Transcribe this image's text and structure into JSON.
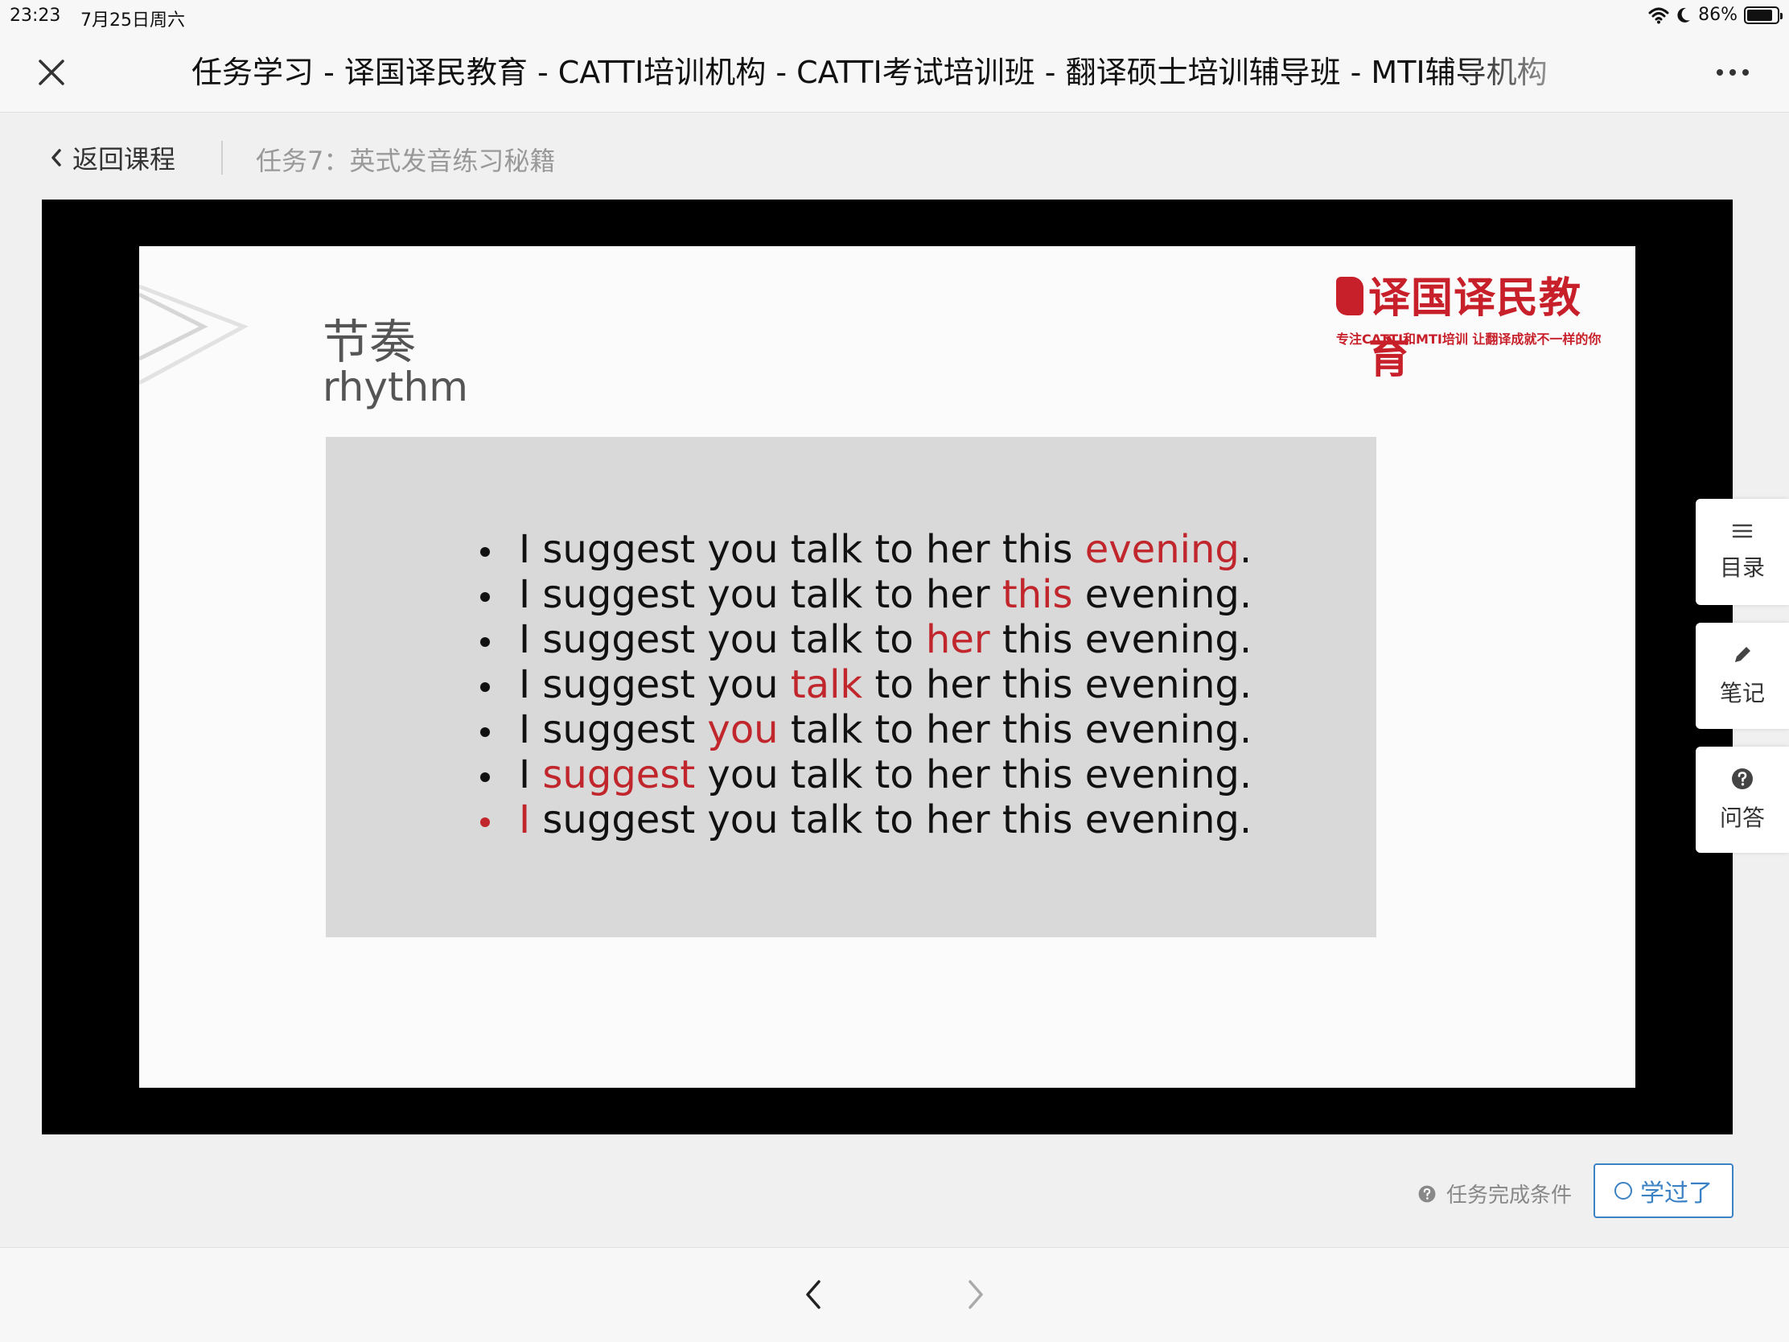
{
  "status_bar": {
    "time": "23:23",
    "date": "7月25日周六",
    "battery": "86%",
    "battery_level": 0.86
  },
  "header": {
    "title": "任务学习 - 译国译民教育 - CATTI培训机构 - CATTI考试培训班 - 翻译硕士培训辅导班 - MTI辅导机构"
  },
  "breadcrumb": {
    "back_label": "返回课程",
    "task_name": "任务7：英式发音练习秘籍"
  },
  "slide": {
    "title_cn": "节奏",
    "title_en": "rhythm",
    "logo_text": "译国译民教育",
    "logo_slogan": "专注CATTI和MTI培训 让翻译成就不一样的你",
    "sentences": [
      {
        "before": "I suggest you talk to her this ",
        "highlight": "evening",
        "after": "."
      },
      {
        "before": "I suggest you talk to her ",
        "highlight": "this",
        "after": " evening."
      },
      {
        "before": "I suggest you talk to ",
        "highlight": "her",
        "after": " this evening."
      },
      {
        "before": "I suggest you ",
        "highlight": "talk",
        "after": " to her this evening."
      },
      {
        "before": "I suggest ",
        "highlight": "you",
        "after": " talk to her this evening."
      },
      {
        "before": "I ",
        "highlight": "suggest",
        "after": " you talk to her this evening."
      },
      {
        "before": "",
        "highlight": "I",
        "after": " suggest you talk to her this evening."
      }
    ],
    "highlight_color": "#c0262b"
  },
  "side_tools": {
    "catalog": "目录",
    "notes": "笔记",
    "qa": "问答"
  },
  "footer": {
    "completion_condition": "任务完成条件",
    "learned_button": "学过了"
  },
  "colors": {
    "accent": "#3b82c4",
    "brand_red": "#c8202a"
  }
}
